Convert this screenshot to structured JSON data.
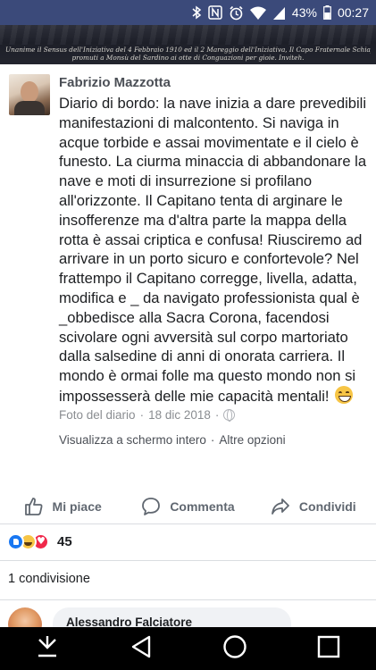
{
  "status_bar": {
    "battery": "43%",
    "time": "00:27",
    "icons": [
      "bluetooth-icon",
      "nfc-icon",
      "alarm-icon",
      "wifi-icon",
      "signal-icon",
      "battery-icon"
    ]
  },
  "cover": {
    "line1": "Unanime il Sensus dell'Iniziativa del 4 Febbraio 1910 ed il 2 Mareggio dell'Iniziativa, Il Capo Fraternale Schiaffino donand",
    "line2": "promuti a Monsù del Sardino ai otte di Conguazioni per gioie. Inviteh."
  },
  "post": {
    "author": "Fabrizio Mazzotta",
    "text_lines": [
      "Diario di bordo: la nave inizia a dare prevedibili",
      "manifestazioni di malcontento. Si naviga in",
      "acque torbide e assai movimentate e il cielo è",
      "funesto. La ciurma minaccia di abbandonare la",
      "nave e moti di insurrezione si profilano",
      "all'orizzonte. Il Capitano tenta di arginare le",
      "insofferenze ma d'altra parte la mappa della",
      "rotta è assai criptica e confusa! Riusciremo ad",
      "arrivare in un porto sicuro e confortevole? Nel",
      "frattempo il Capitano corregge, livella, adatta,",
      "modifica e _ da navigato professionista qual è",
      "_obbedisce alla Sacra Corona, facendosi",
      "scivolare ogni avversità sul corpo martoriato",
      "dalla salsedine di anni di onorata carriera. Il",
      "mondo è ormai folle ma questo mondo non si",
      "impossesserà delle mie capacità mentali!"
    ],
    "album": "Foto del diario",
    "dot": "·",
    "date": "18 dic 2018",
    "link_fullscreen": "Visualizza a schermo intero",
    "link_sep": "·",
    "link_more": "Altre opzioni"
  },
  "actions": {
    "like": "Mi piace",
    "comment": "Commenta",
    "share": "Condividi"
  },
  "reactions": {
    "count": "45",
    "types": [
      "like",
      "haha",
      "love"
    ]
  },
  "shares": "1 condivisione",
  "comment_preview": {
    "name": "Alessandro Falciatore"
  },
  "colors": {
    "status_bar": "#3b4a7a",
    "text": "#1c1e21",
    "meta": "#8a8d91",
    "action": "#606770",
    "like_blue": "#1877f2"
  }
}
